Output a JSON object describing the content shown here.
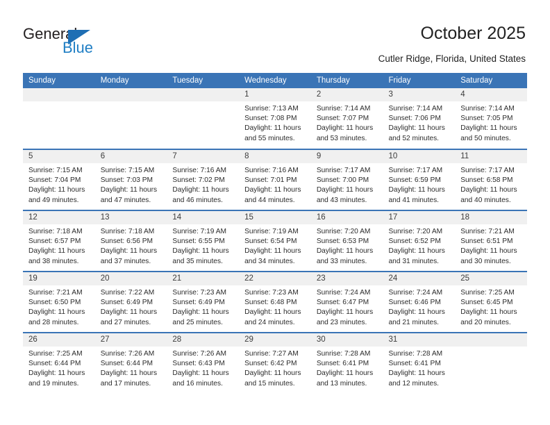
{
  "logo": {
    "word_one": "General",
    "word_two": "Blue",
    "accent_color": "#1f7ec4"
  },
  "header": {
    "title": "October 2025",
    "subtitle": "Cutler Ridge, Florida, United States"
  },
  "theme": {
    "header_row_bg": "#3a74b6",
    "daynum_bg": "#f0f0f0",
    "row_border": "#3a74b6"
  },
  "weekday_headers": [
    "Sunday",
    "Monday",
    "Tuesday",
    "Wednesday",
    "Thursday",
    "Friday",
    "Saturday"
  ],
  "labels": {
    "sunrise": "Sunrise:",
    "sunset": "Sunset:",
    "daylight": "Daylight:"
  },
  "weeks": [
    [
      {
        "day": "",
        "empty": true
      },
      {
        "day": "",
        "empty": true
      },
      {
        "day": "",
        "empty": true
      },
      {
        "day": "1",
        "sunrise": "Sunrise: 7:13 AM",
        "sunset": "Sunset: 7:08 PM",
        "daylight_1": "Daylight: 11 hours",
        "daylight_2": "and 55 minutes."
      },
      {
        "day": "2",
        "sunrise": "Sunrise: 7:14 AM",
        "sunset": "Sunset: 7:07 PM",
        "daylight_1": "Daylight: 11 hours",
        "daylight_2": "and 53 minutes."
      },
      {
        "day": "3",
        "sunrise": "Sunrise: 7:14 AM",
        "sunset": "Sunset: 7:06 PM",
        "daylight_1": "Daylight: 11 hours",
        "daylight_2": "and 52 minutes."
      },
      {
        "day": "4",
        "sunrise": "Sunrise: 7:14 AM",
        "sunset": "Sunset: 7:05 PM",
        "daylight_1": "Daylight: 11 hours",
        "daylight_2": "and 50 minutes."
      }
    ],
    [
      {
        "day": "5",
        "sunrise": "Sunrise: 7:15 AM",
        "sunset": "Sunset: 7:04 PM",
        "daylight_1": "Daylight: 11 hours",
        "daylight_2": "and 49 minutes."
      },
      {
        "day": "6",
        "sunrise": "Sunrise: 7:15 AM",
        "sunset": "Sunset: 7:03 PM",
        "daylight_1": "Daylight: 11 hours",
        "daylight_2": "and 47 minutes."
      },
      {
        "day": "7",
        "sunrise": "Sunrise: 7:16 AM",
        "sunset": "Sunset: 7:02 PM",
        "daylight_1": "Daylight: 11 hours",
        "daylight_2": "and 46 minutes."
      },
      {
        "day": "8",
        "sunrise": "Sunrise: 7:16 AM",
        "sunset": "Sunset: 7:01 PM",
        "daylight_1": "Daylight: 11 hours",
        "daylight_2": "and 44 minutes."
      },
      {
        "day": "9",
        "sunrise": "Sunrise: 7:17 AM",
        "sunset": "Sunset: 7:00 PM",
        "daylight_1": "Daylight: 11 hours",
        "daylight_2": "and 43 minutes."
      },
      {
        "day": "10",
        "sunrise": "Sunrise: 7:17 AM",
        "sunset": "Sunset: 6:59 PM",
        "daylight_1": "Daylight: 11 hours",
        "daylight_2": "and 41 minutes."
      },
      {
        "day": "11",
        "sunrise": "Sunrise: 7:17 AM",
        "sunset": "Sunset: 6:58 PM",
        "daylight_1": "Daylight: 11 hours",
        "daylight_2": "and 40 minutes."
      }
    ],
    [
      {
        "day": "12",
        "sunrise": "Sunrise: 7:18 AM",
        "sunset": "Sunset: 6:57 PM",
        "daylight_1": "Daylight: 11 hours",
        "daylight_2": "and 38 minutes."
      },
      {
        "day": "13",
        "sunrise": "Sunrise: 7:18 AM",
        "sunset": "Sunset: 6:56 PM",
        "daylight_1": "Daylight: 11 hours",
        "daylight_2": "and 37 minutes."
      },
      {
        "day": "14",
        "sunrise": "Sunrise: 7:19 AM",
        "sunset": "Sunset: 6:55 PM",
        "daylight_1": "Daylight: 11 hours",
        "daylight_2": "and 35 minutes."
      },
      {
        "day": "15",
        "sunrise": "Sunrise: 7:19 AM",
        "sunset": "Sunset: 6:54 PM",
        "daylight_1": "Daylight: 11 hours",
        "daylight_2": "and 34 minutes."
      },
      {
        "day": "16",
        "sunrise": "Sunrise: 7:20 AM",
        "sunset": "Sunset: 6:53 PM",
        "daylight_1": "Daylight: 11 hours",
        "daylight_2": "and 33 minutes."
      },
      {
        "day": "17",
        "sunrise": "Sunrise: 7:20 AM",
        "sunset": "Sunset: 6:52 PM",
        "daylight_1": "Daylight: 11 hours",
        "daylight_2": "and 31 minutes."
      },
      {
        "day": "18",
        "sunrise": "Sunrise: 7:21 AM",
        "sunset": "Sunset: 6:51 PM",
        "daylight_1": "Daylight: 11 hours",
        "daylight_2": "and 30 minutes."
      }
    ],
    [
      {
        "day": "19",
        "sunrise": "Sunrise: 7:21 AM",
        "sunset": "Sunset: 6:50 PM",
        "daylight_1": "Daylight: 11 hours",
        "daylight_2": "and 28 minutes."
      },
      {
        "day": "20",
        "sunrise": "Sunrise: 7:22 AM",
        "sunset": "Sunset: 6:49 PM",
        "daylight_1": "Daylight: 11 hours",
        "daylight_2": "and 27 minutes."
      },
      {
        "day": "21",
        "sunrise": "Sunrise: 7:23 AM",
        "sunset": "Sunset: 6:49 PM",
        "daylight_1": "Daylight: 11 hours",
        "daylight_2": "and 25 minutes."
      },
      {
        "day": "22",
        "sunrise": "Sunrise: 7:23 AM",
        "sunset": "Sunset: 6:48 PM",
        "daylight_1": "Daylight: 11 hours",
        "daylight_2": "and 24 minutes."
      },
      {
        "day": "23",
        "sunrise": "Sunrise: 7:24 AM",
        "sunset": "Sunset: 6:47 PM",
        "daylight_1": "Daylight: 11 hours",
        "daylight_2": "and 23 minutes."
      },
      {
        "day": "24",
        "sunrise": "Sunrise: 7:24 AM",
        "sunset": "Sunset: 6:46 PM",
        "daylight_1": "Daylight: 11 hours",
        "daylight_2": "and 21 minutes."
      },
      {
        "day": "25",
        "sunrise": "Sunrise: 7:25 AM",
        "sunset": "Sunset: 6:45 PM",
        "daylight_1": "Daylight: 11 hours",
        "daylight_2": "and 20 minutes."
      }
    ],
    [
      {
        "day": "26",
        "sunrise": "Sunrise: 7:25 AM",
        "sunset": "Sunset: 6:44 PM",
        "daylight_1": "Daylight: 11 hours",
        "daylight_2": "and 19 minutes."
      },
      {
        "day": "27",
        "sunrise": "Sunrise: 7:26 AM",
        "sunset": "Sunset: 6:44 PM",
        "daylight_1": "Daylight: 11 hours",
        "daylight_2": "and 17 minutes."
      },
      {
        "day": "28",
        "sunrise": "Sunrise: 7:26 AM",
        "sunset": "Sunset: 6:43 PM",
        "daylight_1": "Daylight: 11 hours",
        "daylight_2": "and 16 minutes."
      },
      {
        "day": "29",
        "sunrise": "Sunrise: 7:27 AM",
        "sunset": "Sunset: 6:42 PM",
        "daylight_1": "Daylight: 11 hours",
        "daylight_2": "and 15 minutes."
      },
      {
        "day": "30",
        "sunrise": "Sunrise: 7:28 AM",
        "sunset": "Sunset: 6:41 PM",
        "daylight_1": "Daylight: 11 hours",
        "daylight_2": "and 13 minutes."
      },
      {
        "day": "31",
        "sunrise": "Sunrise: 7:28 AM",
        "sunset": "Sunset: 6:41 PM",
        "daylight_1": "Daylight: 11 hours",
        "daylight_2": "and 12 minutes."
      },
      {
        "day": "",
        "empty": true
      }
    ]
  ]
}
